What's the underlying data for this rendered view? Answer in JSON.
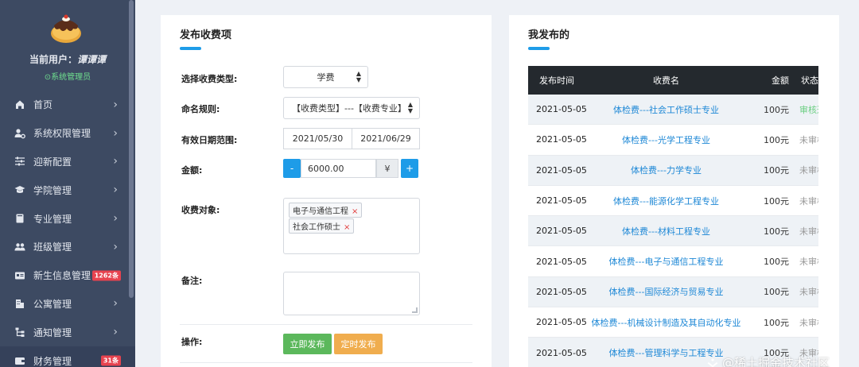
{
  "sidebar": {
    "current_user_label": "当前用户：",
    "current_user_name": "谭谭谭",
    "role": "⊙系统管理员",
    "items": [
      {
        "label": "首页",
        "icon": "home-icon",
        "chevron": "›"
      },
      {
        "label": "系统权限管理",
        "icon": "user-gear-icon",
        "chevron": "›"
      },
      {
        "label": "迎新配置",
        "icon": "sliders-icon",
        "chevron": "›"
      },
      {
        "label": "学院管理",
        "icon": "graduation-cap-icon",
        "chevron": "›"
      },
      {
        "label": "专业管理",
        "icon": "book-icon",
        "chevron": "›"
      },
      {
        "label": "班级管理",
        "icon": "users-icon",
        "chevron": "›"
      },
      {
        "label": "新生信息管理",
        "icon": "id-card-icon",
        "badge": "1262条"
      },
      {
        "label": "公寓管理",
        "icon": "building-icon",
        "chevron": "›"
      },
      {
        "label": "通知管理",
        "icon": "sitemap-icon",
        "chevron": "›"
      },
      {
        "label": "财务管理",
        "icon": "wallet-icon",
        "badge": "31条"
      }
    ]
  },
  "publish_form": {
    "title": "发布收费项",
    "type_label": "选择收费类型:",
    "type_value": "学费",
    "naming_label": "命名规则:",
    "naming_value": "【收费类型】---【收费专业】",
    "date_label": "有效日期范围:",
    "date_start": "2021/05/30",
    "date_end": "2021/06/29",
    "amount_label": "金额:",
    "minus": "-",
    "amount_value": "6000.00",
    "currency": "¥",
    "plus": "+",
    "target_label": "收费对象:",
    "targets": [
      {
        "label": "电子与通信工程",
        "remove": "×"
      },
      {
        "label": "社会工作硕士",
        "remove": "×"
      }
    ],
    "remark_label": "备注:",
    "remark_value": "",
    "action_label": "操作:",
    "publish_now": "立即发布",
    "publish_scheduled": "定时发布",
    "publish_now_color": "#5cb85c",
    "publish_scheduled_color": "#f0ad4e"
  },
  "my_published": {
    "title": "我发布的",
    "headers": [
      "发布时间",
      "收费名",
      "金额",
      "状态"
    ],
    "rows": [
      {
        "date": "2021-05-05",
        "name": "体检费---社会工作硕士专业",
        "amount": "100元",
        "status": "审核通过"
      },
      {
        "date": "2021-05-05",
        "name": "体检费---光学工程专业",
        "amount": "100元",
        "status": "未审核"
      },
      {
        "date": "2021-05-05",
        "name": "体检费---力学专业",
        "amount": "100元",
        "status": "未审核"
      },
      {
        "date": "2021-05-05",
        "name": "体检费---能源化学工程专业",
        "amount": "100元",
        "status": "未审核"
      },
      {
        "date": "2021-05-05",
        "name": "体检费---材料工程专业",
        "amount": "100元",
        "status": "未审核"
      },
      {
        "date": "2021-05-05",
        "name": "体检费---电子与通信工程专业",
        "amount": "100元",
        "status": "未审核"
      },
      {
        "date": "2021-05-05",
        "name": "体检费---国际经济与贸易专业",
        "amount": "100元",
        "status": "未审核"
      },
      {
        "date": "2021-05-05",
        "name": "体检费---机械设计制造及其自动化专业",
        "amount": "100元",
        "status": "未审核"
      },
      {
        "date": "2021-05-05",
        "name": "体检费---管理科学与工程专业",
        "amount": "100元",
        "status": "未审核"
      }
    ]
  },
  "watermark": "@稀土掘金技术社区",
  "colors": {
    "sidebar_bg": "#3d4a62",
    "accent": "#1e9ce8",
    "table_header": "#24292e",
    "link": "#1e88d6"
  }
}
